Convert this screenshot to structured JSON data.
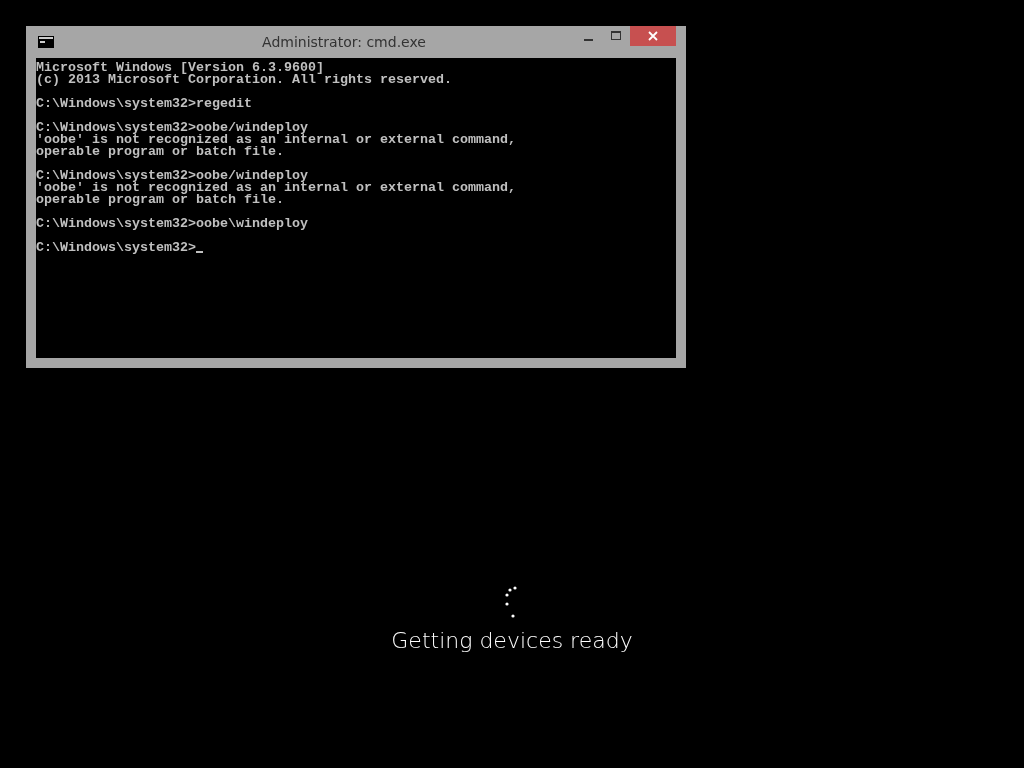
{
  "window": {
    "title": "Administrator: cmd.exe"
  },
  "console": {
    "blocks": [
      [
        "Microsoft Windows [Version 6.3.9600]",
        "(c) 2013 Microsoft Corporation. All rights reserved."
      ],
      [
        "C:\\Windows\\system32>regedit"
      ],
      [
        "C:\\Windows\\system32>oobe/windeploy",
        "'oobe' is not recognized as an internal or external command,",
        "operable program or batch file."
      ],
      [
        "C:\\Windows\\system32>oobe/windeploy",
        "'oobe' is not recognized as an internal or external command,",
        "operable program or batch file."
      ],
      [
        "C:\\Windows\\system32>oobe\\windeploy"
      ],
      [
        "C:\\Windows\\system32>"
      ]
    ],
    "cursor": true
  },
  "status": {
    "message": "Getting devices ready"
  }
}
